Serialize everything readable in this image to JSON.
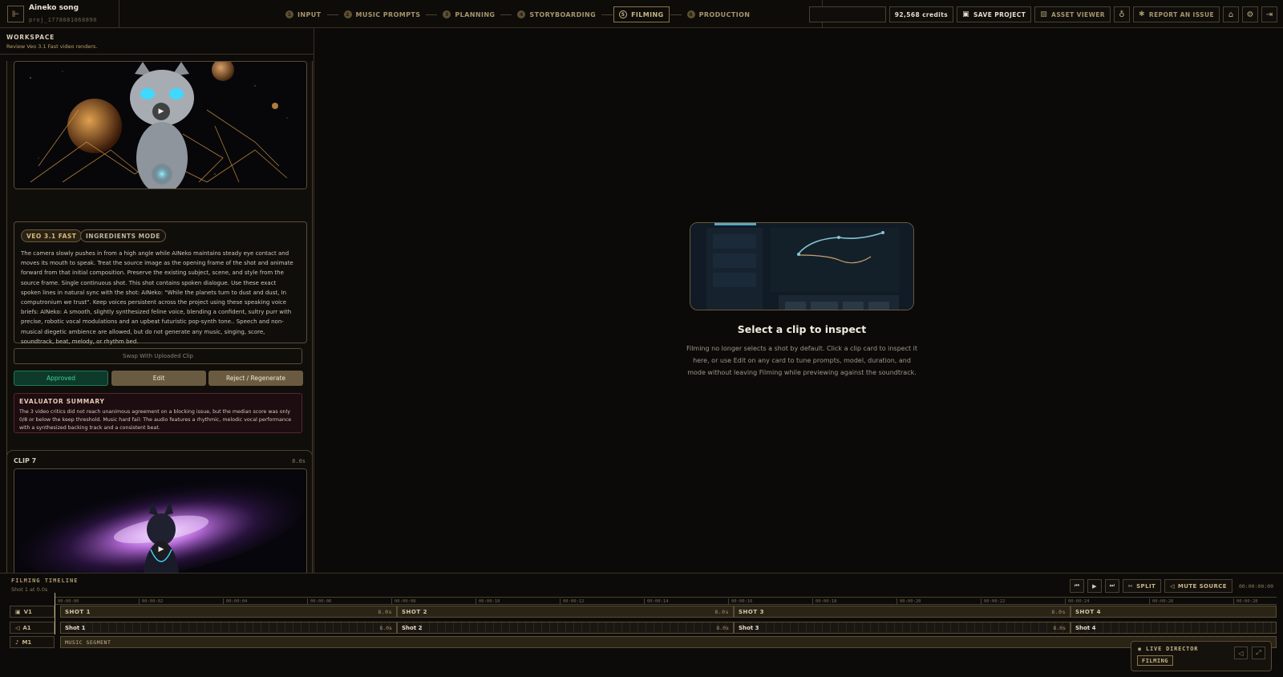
{
  "project": {
    "title": "Aineko song",
    "id": "proj_1778081068890"
  },
  "steps": [
    {
      "num": "1",
      "label": "INPUT"
    },
    {
      "num": "2",
      "label": "MUSIC PROMPTS"
    },
    {
      "num": "3",
      "label": "PLANNING"
    },
    {
      "num": "4",
      "label": "STORYBOARDING"
    },
    {
      "num": "5",
      "label": "FILMING",
      "active": true
    },
    {
      "num": "6",
      "label": "PRODUCTION"
    }
  ],
  "toolbar": {
    "credits": "92,568 credits",
    "save_label": "SAVE PROJECT",
    "asset_viewer_label": "ASSET VIEWER",
    "report_label": "REPORT AN ISSUE"
  },
  "workspace": {
    "label": "WORKSPACE",
    "subtitle": "Review Veo 3.1 Fast video renders."
  },
  "clip6": {
    "chips": [
      "VEO 3.1 FAST",
      "INGREDIENTS MODE"
    ],
    "prompt": "The camera slowly pushes in from a high angle while AINeko maintains steady eye contact and moves its mouth to speak. Treat the source image as the opening frame of the shot and animate forward from that initial composition. Preserve the existing subject, scene, and style from the source frame. Single continuous shot. This shot contains spoken dialogue. Use these exact spoken lines in natural sync with the shot: AINeko: \"While the planets turn to dust and dust, In computronium we trust\". Keep voices persistent across the project using these speaking voice briefs: AINeko: A smooth, slightly synthesized feline voice, blending a confident, sultry purr with precise, robotic vocal modulations and an upbeat futuristic pop-synth tone.. Speech and non-musical diegetic ambience are allowed, but do not generate any music, singing, score, soundtrack, beat, melody, or rhythm bed.",
    "swap_label": "Swap With Uploaded Clip",
    "approved_label": "Approved",
    "edit_label": "Edit",
    "reject_label": "Reject / Regenerate",
    "eval_title": "EVALUATOR SUMMARY",
    "eval_text": "The 3 video critics did not reach unanimous agreement on a blocking issue, but the median score was only 0/8 or below the keep threshold. Music hard fail: The audio features a rhythmic, melodic vocal performance with a synthesized backing track and a consistent beat."
  },
  "clip7": {
    "title": "CLIP 7",
    "duration": "8.0s"
  },
  "inspector": {
    "title": "Select a clip to inspect",
    "text": "Filming no longer selects a shot by default. Click a clip card to inspect it here, or use Edit on any card to tune prompts, model, duration, and mode without leaving Filming while previewing against the soundtrack."
  },
  "timeline": {
    "title": "FILMING TIMELINE",
    "subtitle": "Shot 1 at 0.0s",
    "split_label": "SPLIT",
    "mute_label": "MUTE SOURCE",
    "timecode": "00:00:00:00",
    "ticks": [
      "00:00:00",
      "00:00:02",
      "00:00:04",
      "00:00:06",
      "00:00:08",
      "00:00:10",
      "00:00:12",
      "00:00:14",
      "00:00:16",
      "00:00:18",
      "00:00:20",
      "00:00:22",
      "00:00:24",
      "00:00:26",
      "00:00:28"
    ],
    "tracks": {
      "v1": "V1",
      "a1": "A1",
      "m1": "M1"
    },
    "video_segments": [
      {
        "label": "SHOT 1",
        "duration": "8.0s"
      },
      {
        "label": "SHOT 2",
        "duration": "8.0s"
      },
      {
        "label": "SHOT 3",
        "duration": "8.0s"
      },
      {
        "label": "SHOT 4",
        "duration": ""
      }
    ],
    "audio_segments": [
      {
        "label": "Shot 1",
        "duration": "8.0s"
      },
      {
        "label": "Shot 2",
        "duration": "8.0s"
      },
      {
        "label": "Shot 3",
        "duration": "8.0s"
      },
      {
        "label": "Shot 4",
        "duration": ""
      }
    ],
    "music_segment": "MUSIC SEGMENT"
  },
  "live_director": {
    "title": "LIVE DIRECTOR",
    "badge": "FILMING"
  }
}
